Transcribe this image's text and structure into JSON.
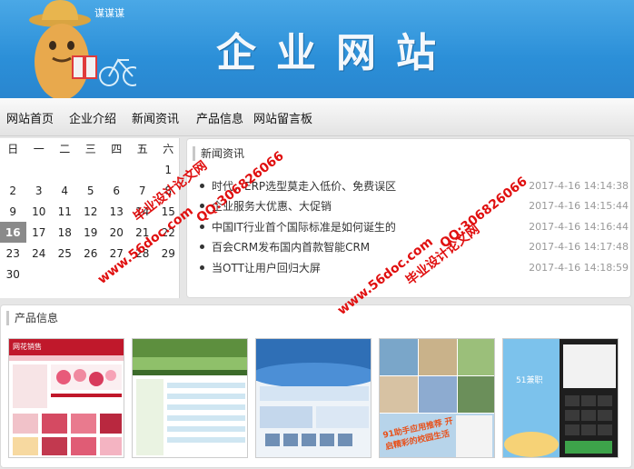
{
  "banner": {
    "title": "企业网站",
    "bubble": "谋谋谋"
  },
  "nav": {
    "items": [
      "网站首页",
      "企业介绍",
      "新闻资讯",
      "产品信息",
      "网站留言板"
    ]
  },
  "calendar": {
    "weekdays": [
      "日",
      "一",
      "二",
      "三",
      "四",
      "五",
      "六"
    ],
    "days": [
      "",
      "",
      "",
      "",
      "",
      "",
      "1",
      "2",
      "3",
      "4",
      "5",
      "6",
      "7",
      "8",
      "9",
      "10",
      "11",
      "12",
      "13",
      "14",
      "15",
      "16",
      "17",
      "18",
      "19",
      "20",
      "21",
      "22",
      "23",
      "24",
      "25",
      "26",
      "27",
      "28",
      "29",
      "30",
      "",
      "",
      "",
      "",
      "",
      ""
    ],
    "today": "16"
  },
  "news": {
    "title": "新闻资讯",
    "items": [
      {
        "text": "时代，ERP选型莫走入低价、免费误区",
        "date": "2017-4-16 14:14:38"
      },
      {
        "text": "企业服务大优惠、大促销",
        "date": "2017-4-16 14:15:44"
      },
      {
        "text": "中国IT行业首个国际标准是如何诞生的",
        "date": "2017-4-16 14:16:44"
      },
      {
        "text": "百会CRM发布国内首款智能CRM",
        "date": "2017-4-16 14:17:48"
      },
      {
        "text": "当OTT让用户回归大屏",
        "date": "2017-4-16 14:18:59"
      }
    ]
  },
  "products": {
    "title": "产品信息",
    "thumb_1_text": "网花销售",
    "thumb_5_text": "51兼职",
    "thumb_4_text": "91助手应用推荐 开启精彩的校园生活"
  },
  "watermark": {
    "line1": "毕业设计论文网",
    "line2": "QQ:306826066",
    "line3": "www.56doc.com"
  },
  "colors": {
    "banner": "#2b8fd8",
    "watermark": "#e01010",
    "today_bg": "#8a8a8a"
  }
}
